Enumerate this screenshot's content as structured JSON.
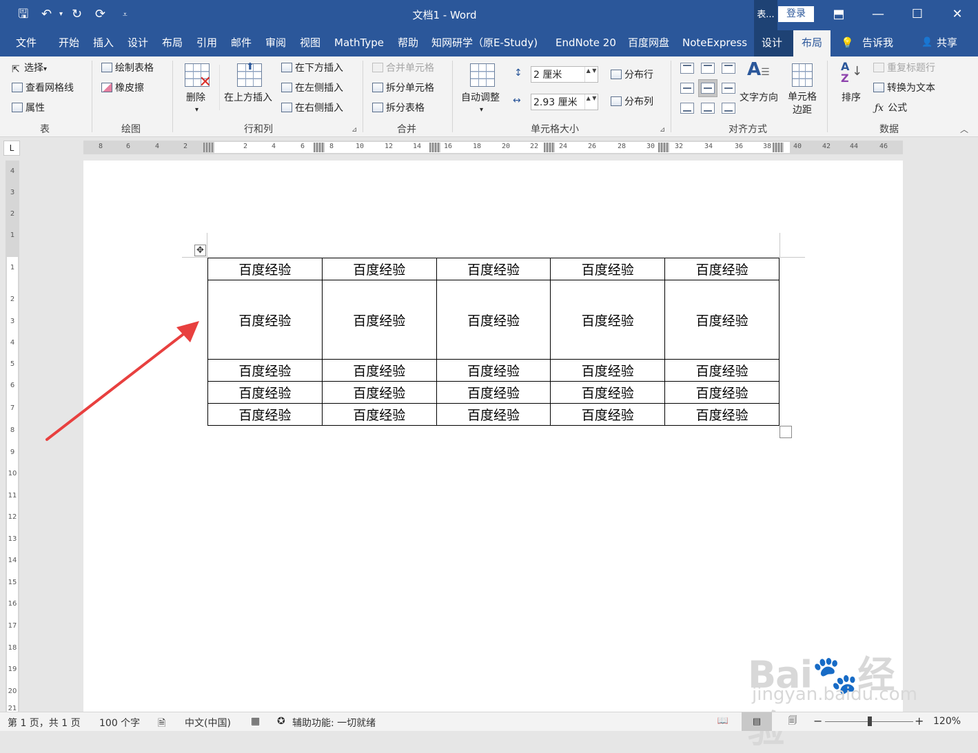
{
  "titlebar": {
    "title": "文档1  -  Word",
    "context_label": "表...",
    "login_label": "登录",
    "qat": {
      "save_icon": "save-icon",
      "undo_icon": "undo-icon",
      "redo_icon": "redo-icon",
      "refresh_icon": "refresh-icon",
      "customize_icon": "customize-icon"
    },
    "save_glyph": "🖫",
    "undo_glyph": "↶",
    "undo_drop_glyph": "▾",
    "redo_glyph": "↻",
    "refresh_glyph": "⟳",
    "customize_glyph": "⩡",
    "ribbon_options_glyph": "⬒",
    "minimize_glyph": "—",
    "maximize_glyph": "☐",
    "close_glyph": "✕"
  },
  "tabs": [
    {
      "label": "文件"
    },
    {
      "label": "开始"
    },
    {
      "label": "插入"
    },
    {
      "label": "设计"
    },
    {
      "label": "布局"
    },
    {
      "label": "引用"
    },
    {
      "label": "邮件"
    },
    {
      "label": "审阅"
    },
    {
      "label": "视图"
    },
    {
      "label": "MathType"
    },
    {
      "label": "帮助"
    },
    {
      "label": "知网研学（原E-Study)"
    },
    {
      "label": "EndNote 20"
    },
    {
      "label": "百度网盘"
    },
    {
      "label": "NoteExpress"
    },
    {
      "label": "设计"
    },
    {
      "label": "布局"
    }
  ],
  "tell_me": "告诉我",
  "tell_me_glyph": "💡",
  "share": "共享",
  "share_glyph": "👤",
  "ribbon": {
    "table_group": {
      "label": "表",
      "select": "选择",
      "select_drop": "▾",
      "gridlines": "查看网格线",
      "properties": "属性"
    },
    "draw_group": {
      "label": "绘图",
      "draw_table": "绘制表格",
      "eraser": "橡皮擦"
    },
    "rows_cols_group": {
      "label": "行和列",
      "delete": "删除",
      "delete_drop": "▾",
      "insert_above": "在上方插入",
      "insert_below": "在下方插入",
      "insert_left": "在左侧插入",
      "insert_right": "在右侧插入"
    },
    "merge_group": {
      "label": "合并",
      "merge_cells": "合并单元格",
      "split_cells": "拆分单元格",
      "split_table": "拆分表格"
    },
    "cell_size_group": {
      "label": "单元格大小",
      "autofit": "自动调整",
      "autofit_drop": "▾",
      "height": "2 厘米",
      "width": "2.93 厘米",
      "spin_arrows": "▲ ▼",
      "distribute_rows": "分布行",
      "distribute_cols": "分布列"
    },
    "align_group": {
      "label": "对齐方式",
      "text_direction": "文字方向",
      "cell_margins": "单元格边距"
    },
    "data_group": {
      "label": "数据",
      "sort": "排序",
      "repeat_header": "重复标题行",
      "convert_text": "转换为文本",
      "formula": "公式",
      "fx_glyph": "ƒx"
    },
    "dialog_launcher_glyph": "⊿",
    "collapse_glyph": "︿"
  },
  "ruler": {
    "corner_glyph": "L",
    "h_ticks": [
      "8",
      "6",
      "4",
      "2",
      "2",
      "4",
      "6",
      "8",
      "10",
      "12",
      "14",
      "16",
      "18",
      "20",
      "22",
      "24",
      "26",
      "28",
      "30",
      "32",
      "34",
      "36",
      "38",
      "40",
      "42",
      "44",
      "46"
    ],
    "v_ticks": [
      "4",
      "3",
      "2",
      "1",
      "1",
      "2",
      "3",
      "4",
      "5",
      "6",
      "7",
      "8",
      "9",
      "10",
      "11",
      "12",
      "13",
      "14",
      "15",
      "16",
      "17",
      "18",
      "19",
      "20",
      "21"
    ]
  },
  "document": {
    "move_handle_glyph": "✥",
    "table": {
      "rows": [
        [
          "百度经验",
          "百度经验",
          "百度经验",
          "百度经验",
          "百度经验"
        ],
        [
          "百度经验",
          "百度经验",
          "百度经验",
          "百度经验",
          "百度经验"
        ],
        [
          "百度经验",
          "百度经验",
          "百度经验",
          "百度经验",
          "百度经验"
        ],
        [
          "百度经验",
          "百度经验",
          "百度经验",
          "百度经验",
          "百度经验"
        ],
        [
          "百度经验",
          "百度经验",
          "百度经验",
          "百度经验",
          "百度经验"
        ]
      ]
    },
    "arrow_color": "#e8403f"
  },
  "watermark": {
    "brand": "Bai🐾经验",
    "url": "jingyan.baidu.com"
  },
  "statusbar": {
    "page": "第 1 页，共 1 页",
    "words": "100 个字",
    "proofing_glyph": "🗎",
    "language": "中文(中国)",
    "macro_glyph": "▦",
    "accessibility": "辅助功能: 一切就绪",
    "accessibility_glyph": "✪",
    "read_mode_glyph": "📖",
    "print_layout_glyph": "▤",
    "web_layout_glyph": "🗐",
    "zoom_out_glyph": "−",
    "zoom_in_glyph": "+",
    "zoom_level": 120,
    "zoom": "120%"
  },
  "colors": {
    "word_blue": "#2b579a",
    "ribbon_bg": "#f3f3f3",
    "page_bg": "#ffffff",
    "workspace_bg": "#e6e6e6"
  }
}
